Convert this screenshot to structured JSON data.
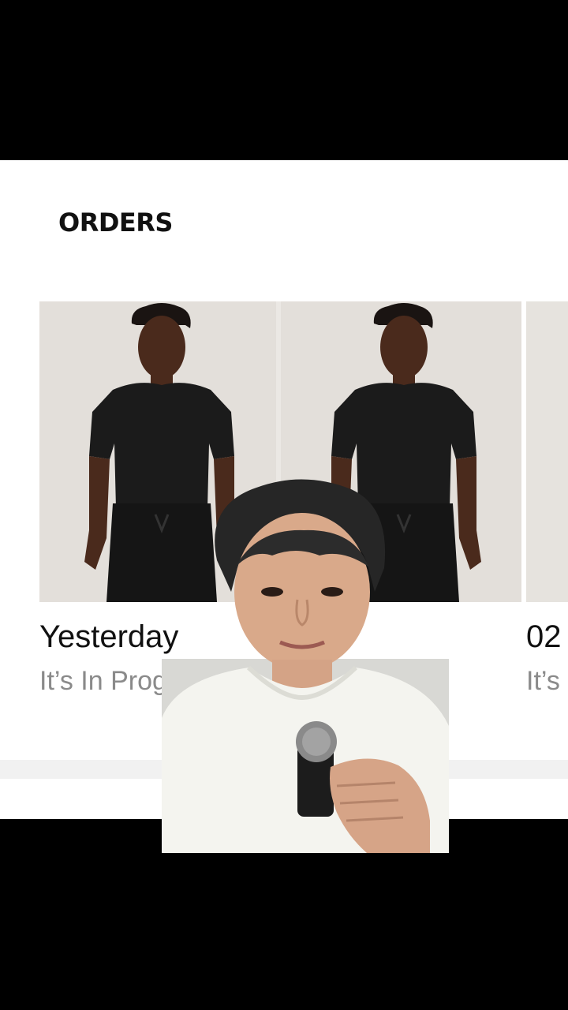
{
  "page": {
    "title": "ORDERS"
  },
  "orders": [
    {
      "date": "Yesterday",
      "status": "It’s In Progress",
      "image": "product-photo-black-tee-and-joggers"
    },
    {
      "date": "02",
      "status": "It’s",
      "image": "product-photo"
    }
  ],
  "overlay": {
    "type": "presenter-video",
    "image": "presenter-holding-microphone"
  },
  "colors": {
    "app_background": "#ffffff",
    "letterbox": "#000000",
    "title_text": "#111111",
    "status_text": "#8a8a8a",
    "image_background": "#e3dfda"
  }
}
